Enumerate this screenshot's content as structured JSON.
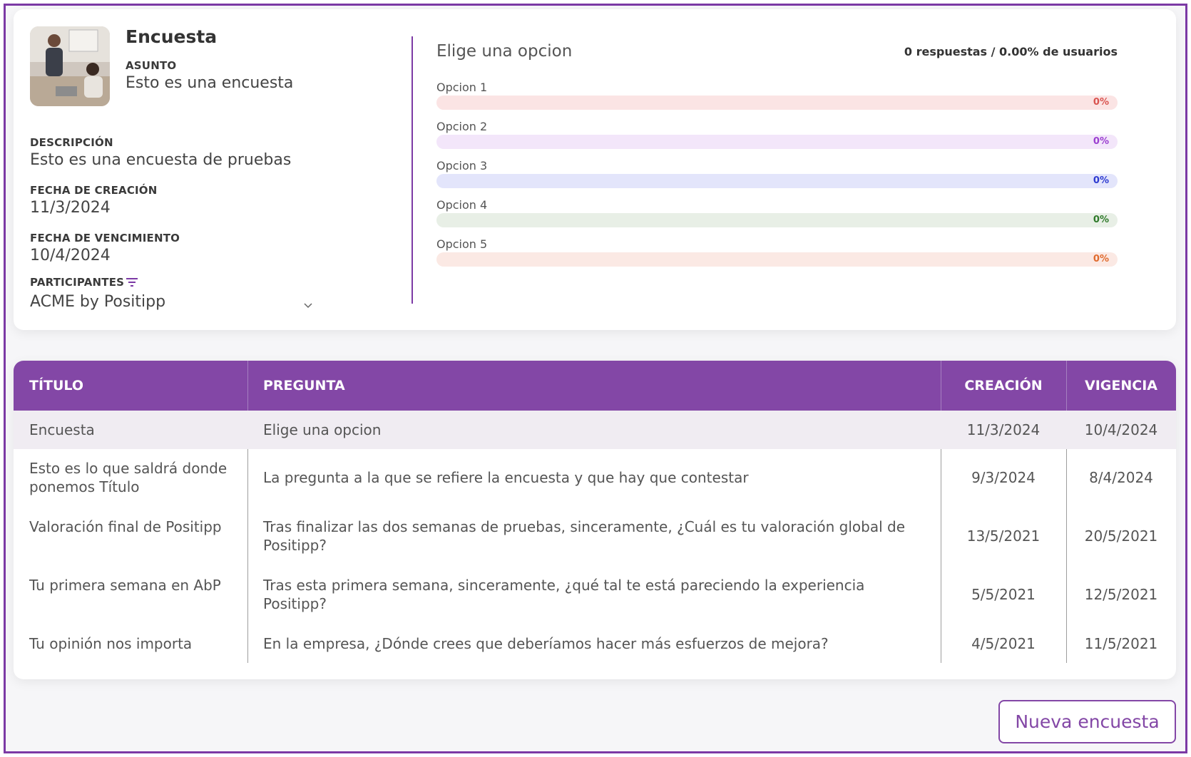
{
  "survey": {
    "title": "Encuesta",
    "subject_label": "ASUNTO",
    "subject": "Esto es una encuesta",
    "description_label": "DESCRIPCIÓN",
    "description": "Esto es una encuesta de pruebas",
    "created_label": "FECHA DE CREACIÓN",
    "created": "11/3/2024",
    "expires_label": "FECHA DE VENCIMIENTO",
    "expires": "10/4/2024",
    "participants_label": "PARTICIPANTES",
    "participants": "ACME by Positipp"
  },
  "question": {
    "title": "Elige una opcion",
    "stats": "0 respuestas / 0.00% de usuarios",
    "options": [
      {
        "label": "Opcion 1",
        "percent_text": "0%",
        "value": 0,
        "bar_color": "#fbe4e4",
        "text_color": "#d9534f"
      },
      {
        "label": "Opcion 2",
        "percent_text": "0%",
        "value": 0,
        "bar_color": "#f3e6fa",
        "text_color": "#9b3fd1"
      },
      {
        "label": "Opcion 3",
        "percent_text": "0%",
        "value": 0,
        "bar_color": "#e3e5fb",
        "text_color": "#2e3bd1"
      },
      {
        "label": "Opcion 4",
        "percent_text": "0%",
        "value": 0,
        "bar_color": "#e8efe6",
        "text_color": "#2f7a2a"
      },
      {
        "label": "Opcion 5",
        "percent_text": "0%",
        "value": 0,
        "bar_color": "#fbe9e4",
        "text_color": "#e06b2e"
      }
    ]
  },
  "table": {
    "headers": [
      "TÍTULO",
      "PREGUNTA",
      "CREACIÓN",
      "VIGENCIA"
    ],
    "rows": [
      {
        "title": "Encuesta",
        "question": "Elige una opcion",
        "created": "11/3/2024",
        "valid": "10/4/2024"
      },
      {
        "title": "Esto es lo que saldrá donde ponemos Título",
        "question": "La pregunta a la que se refiere la encuesta y que hay que contestar",
        "created": "9/3/2024",
        "valid": "8/4/2024"
      },
      {
        "title": "Valoración final de Positipp",
        "question": "Tras finalizar las dos semanas de pruebas, sinceramente, ¿Cuál es tu valoración global de Positipp?",
        "created": "13/5/2021",
        "valid": "20/5/2021"
      },
      {
        "title": "Tu primera semana en AbP",
        "question": "Tras esta primera semana, sinceramente, ¿qué tal te está pareciendo la experiencia Positipp?",
        "created": "5/5/2021",
        "valid": "12/5/2021"
      },
      {
        "title": "Tu opinión nos importa",
        "question": "En la empresa, ¿Dónde crees que deberíamos hacer más esfuerzos de mejora?",
        "created": "4/5/2021",
        "valid": "11/5/2021"
      }
    ]
  },
  "actions": {
    "new_survey": "Nueva encuesta"
  },
  "colors": {
    "accent": "#8347a6",
    "highlight_row": "#f0ecf2"
  }
}
